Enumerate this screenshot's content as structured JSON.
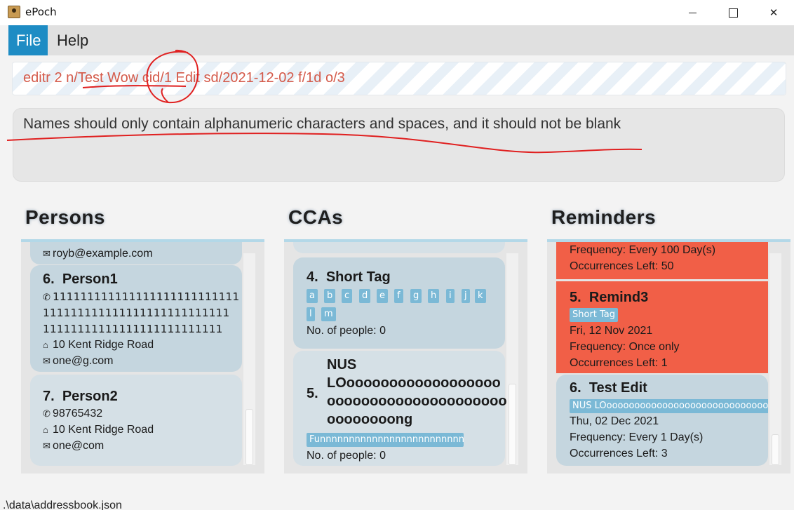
{
  "window": {
    "title": "ePoch"
  },
  "menu": {
    "file": "File",
    "help": "Help"
  },
  "command": {
    "text": "editr 2 n/Test Wow cid/1 Edit sd/2021-12-02 f/1d o/3"
  },
  "result": {
    "text": "Names should only contain alphanumeric characters and spaces, and it should not be blank"
  },
  "panels": {
    "persons": {
      "title": "Persons",
      "partial_email": "royb@example.com",
      "cards": [
        {
          "index": "6.",
          "name": "Person1",
          "phone_lines": [
            "111111111111111111111111111",
            "111111111111111111111111111",
            "11111111111111111111111111"
          ],
          "address": "10 Kent Ridge Road",
          "email": "one@g.com"
        },
        {
          "index": "7.",
          "name": "Person2",
          "phone": "98765432",
          "address": "10 Kent Ridge Road",
          "email": "one@com"
        }
      ]
    },
    "ccas": {
      "title": "CCAs",
      "cards": [
        {
          "index": "4.",
          "name": "Short Tag",
          "tags": [
            "a",
            "b",
            "c",
            "d",
            "e",
            "f",
            "g",
            "h",
            "i",
            "j",
            "k",
            "l",
            "m"
          ],
          "people": "No. of people: 0"
        },
        {
          "index": "5.",
          "name_lines": [
            "NUS",
            "LOoooooooooooooooooo",
            "ooooooooooooooooooooo",
            "oooooooong"
          ],
          "tag": "Funnnnnnnnnnnnnnnnnnnnnnnnn",
          "people": "No. of people: 0"
        }
      ]
    },
    "reminders": {
      "title": "Reminders",
      "partial": {
        "frequency": "Frequency: Every 100 Day(s)",
        "occurrences": "Occurrences Left: 50"
      },
      "cards": [
        {
          "index": "5.",
          "name": "Remind3",
          "tag": "Short Tag",
          "date": "Fri, 12 Nov 2021",
          "frequency": "Frequency: Once only",
          "occurrences": "Occurrences Left: 1"
        },
        {
          "index": "6.",
          "name": "Test Edit",
          "tag": "NUS LOoooooooooooooooooooooooooooooooooooong",
          "date": "Thu, 02 Dec 2021",
          "frequency": "Frequency: Every 1 Day(s)",
          "occurrences": "Occurrences Left: 3"
        }
      ]
    }
  },
  "status": {
    "path": ".\\data\\addressbook.json"
  },
  "icons": {
    "phone": "phone-icon",
    "home": "home-icon",
    "email": "email-icon"
  },
  "colors": {
    "accent": "#1e8cc4",
    "overdue_card": "#f15f47",
    "tag": "#7bb9d6",
    "annotation": "#e02020"
  }
}
